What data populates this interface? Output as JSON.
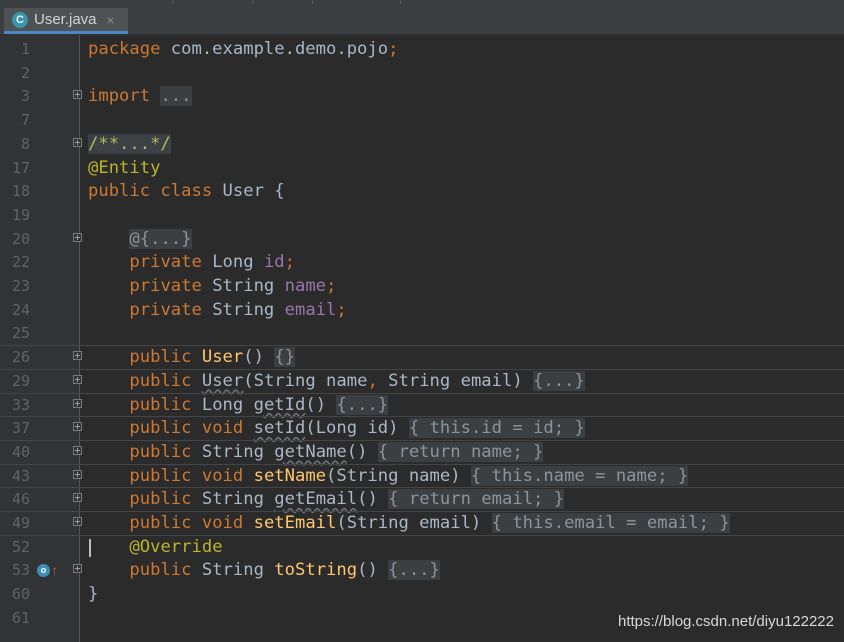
{
  "tab": {
    "label": "User.java",
    "icon": "C",
    "close": "×"
  },
  "lines": [
    {
      "n": "1",
      "fold": false,
      "sep": false,
      "html": "<span class='kw'>package</span> com.example.demo.pojo<span class='kw'>;</span>"
    },
    {
      "n": "2",
      "fold": false,
      "sep": false,
      "html": ""
    },
    {
      "n": "3",
      "fold": true,
      "sep": false,
      "html": "<span class='kw'>import</span> <span class='fe'>...</span>"
    },
    {
      "n": "7",
      "fold": false,
      "sep": false,
      "html": ""
    },
    {
      "n": "8",
      "fold": true,
      "sep": false,
      "html": "<span class='ann-fold'>/**...*/</span>"
    },
    {
      "n": "17",
      "fold": false,
      "sep": false,
      "html": "<span class='an'>@Entity</span>"
    },
    {
      "n": "18",
      "fold": false,
      "sep": false,
      "html": "<span class='kw'>public class</span> User {"
    },
    {
      "n": "19",
      "fold": false,
      "sep": false,
      "html": ""
    },
    {
      "n": "20",
      "fold": true,
      "sep": false,
      "html": "    <span class='fe'>@{...}</span>"
    },
    {
      "n": "22",
      "fold": false,
      "sep": false,
      "html": "    <span class='kw'>private</span> Long <span class='fd'>id</span><span class='kw'>;</span>"
    },
    {
      "n": "23",
      "fold": false,
      "sep": false,
      "html": "    <span class='kw'>private</span> String <span class='fd'>name</span><span class='kw'>;</span>"
    },
    {
      "n": "24",
      "fold": false,
      "sep": false,
      "html": "    <span class='kw'>private</span> String <span class='fd'>email</span><span class='kw'>;</span>"
    },
    {
      "n": "25",
      "fold": false,
      "sep": false,
      "html": ""
    },
    {
      "n": "26",
      "fold": true,
      "sep": true,
      "html": "    <span class='kw'>public</span> <span class='mt'>User</span>() <span class='fe'>{}</span>"
    },
    {
      "n": "29",
      "fold": true,
      "sep": true,
      "html": "    <span class='kw'>public</span> <span class='uw'>User</span>(String name<span class='kw'>,</span> String email) <span class='fe'>{...}</span>"
    },
    {
      "n": "33",
      "fold": true,
      "sep": true,
      "html": "    <span class='kw'>public</span> Long <span class='uw'>getId</span>() <span class='fe'>{...}</span>"
    },
    {
      "n": "37",
      "fold": true,
      "sep": true,
      "html": "    <span class='kw'>public void</span> <span class='uw'>setId</span>(Long id) <span class='fe'>{ </span><span class='fe kw'>this</span><span class='fe'>.</span><span class='fe fd'>id</span><span class='fe'> = id</span><span class='fe kw'>;</span><span class='fe'> }</span>"
    },
    {
      "n": "40",
      "fold": true,
      "sep": true,
      "html": "    <span class='kw'>public</span> String <span class='uw'>getName</span>() <span class='fe'>{ </span><span class='fe kw'>return</span><span class='fe'> </span><span class='fe fd'>name</span><span class='fe kw'>;</span><span class='fe'> }</span>"
    },
    {
      "n": "43",
      "fold": true,
      "sep": true,
      "html": "    <span class='kw'>public void</span> <span class='mt'>setName</span>(String name) <span class='fe'>{ </span><span class='fe kw'>this</span><span class='fe'>.</span><span class='fe fd'>name</span><span class='fe'> = name</span><span class='fe kw'>;</span><span class='fe'> }</span>"
    },
    {
      "n": "46",
      "fold": true,
      "sep": true,
      "html": "    <span class='kw'>public</span> String <span class='uw'>getEmail</span>() <span class='fe'>{ </span><span class='fe kw'>return</span><span class='fe'> </span><span class='fe fd'>email</span><span class='fe kw'>;</span><span class='fe'> }</span>"
    },
    {
      "n": "49",
      "fold": true,
      "sep": true,
      "html": "    <span class='kw'>public void</span> <span class='mt'>setEmail</span>(String email) <span class='fe'>{ </span><span class='fe kw'>this</span><span class='fe'>.</span><span class='fe fd'>email</span><span class='fe'> = email</span><span class='fe kw'>;</span><span class='fe'> }</span>"
    },
    {
      "n": "52",
      "fold": false,
      "sep": true,
      "html": "    <span class='an'>@Override</span>",
      "caret": true
    },
    {
      "n": "53",
      "fold": true,
      "sep": false,
      "html": "    <span class='kw'>public</span> String <span class='mt'>toString</span>() <span class='fe'>{...}</span>",
      "gutter_icon": true
    },
    {
      "n": "60",
      "fold": false,
      "sep": false,
      "html": "}"
    },
    {
      "n": "61",
      "fold": false,
      "sep": false,
      "html": ""
    }
  ],
  "gutter_icons": {
    "override_icon": "o",
    "up_arrow": "↑"
  },
  "watermark": "https://blog.csdn.net/diyu122222",
  "colors": {
    "keyword": "#cc7832",
    "annotation": "#bbb529",
    "field": "#9876aa",
    "method": "#ffc66d",
    "text": "#a9b7c6",
    "background": "#2b2b2b"
  }
}
